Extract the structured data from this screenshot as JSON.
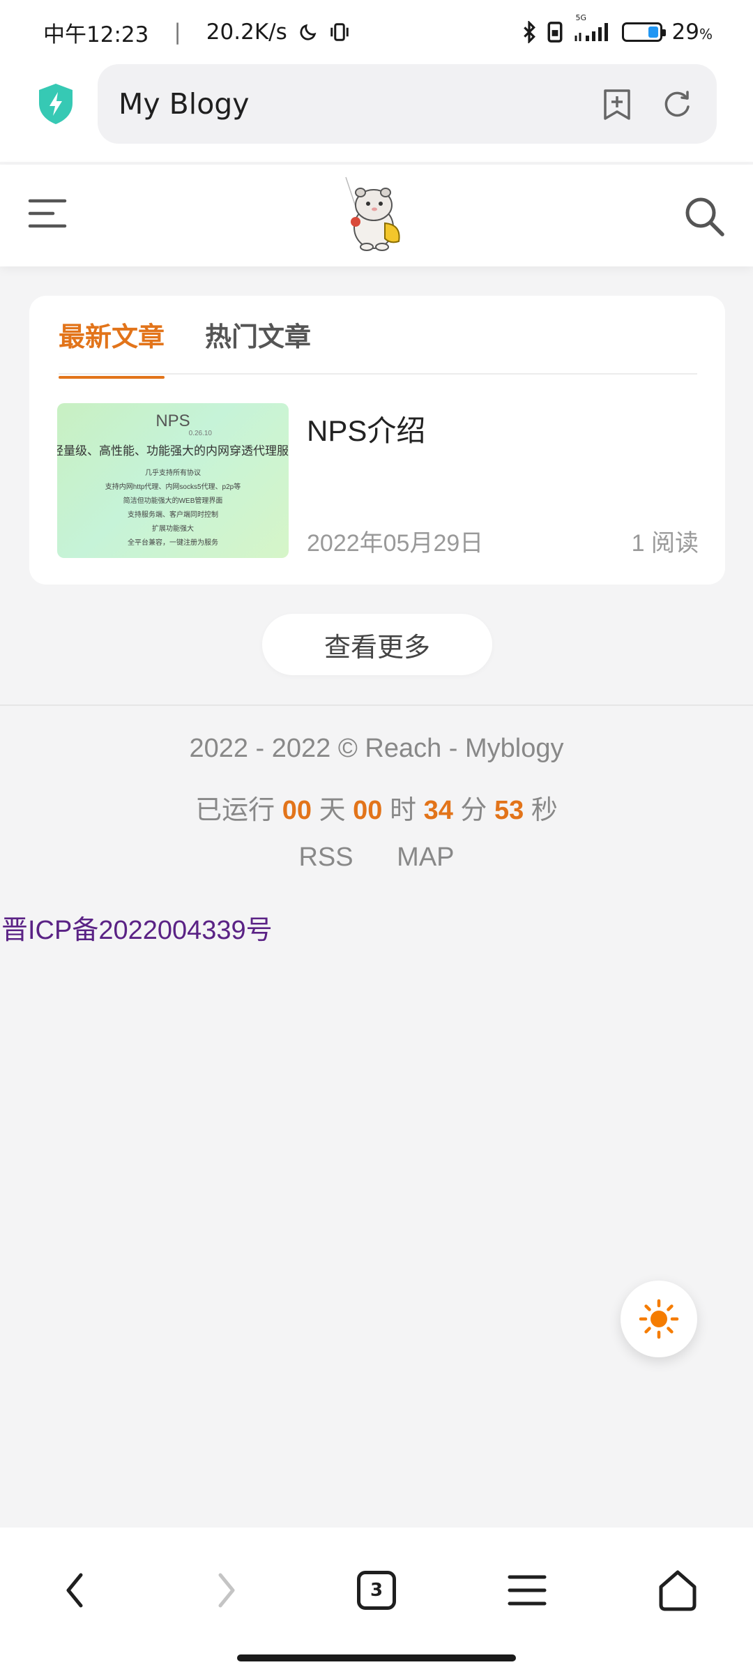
{
  "status_bar": {
    "time": "中午12:23",
    "net_speed": "20.2K/s",
    "network": "5G",
    "battery": "29",
    "battery_unit": "%",
    "battery_level": 0.29
  },
  "browser": {
    "url_text": "My Blogy",
    "tab_count": "3"
  },
  "tabs": [
    {
      "label": "最新文章",
      "active": true
    },
    {
      "label": "热门文章",
      "active": false
    }
  ],
  "article": {
    "title": "NPS介绍",
    "date": "2022年05月29日",
    "reads": "1 阅读",
    "thumbnail": {
      "title": "NPS",
      "version": "0.26.10",
      "subtitle": "轻量级、高性能、功能强大的内网穿透代理服务",
      "lines": [
        "几乎支持所有协议",
        "支持内网http代理、内网socks5代理、p2p等",
        "简洁但功能强大的WEB管理界面",
        "支持服务端、客户端同时控制",
        "扩展功能强大",
        "全平台兼容，一键注册为服务"
      ]
    }
  },
  "more_button": "查看更多",
  "footer": {
    "copyright": "2022 - 2022 © Reach - Myblogy",
    "runtime": {
      "prefix": "已运行",
      "days": "00",
      "days_unit": "天",
      "hours": "00",
      "hours_unit": "时",
      "minutes": "34",
      "minutes_unit": "分",
      "seconds": "53",
      "seconds_unit": "秒"
    },
    "links": [
      "RSS",
      "MAP"
    ],
    "icp": "晋ICP备2022004339号"
  },
  "colors": {
    "accent": "#e2741a",
    "icp_link": "#5a2285",
    "shield": "#36c9b4",
    "sun": "#f57c00"
  }
}
